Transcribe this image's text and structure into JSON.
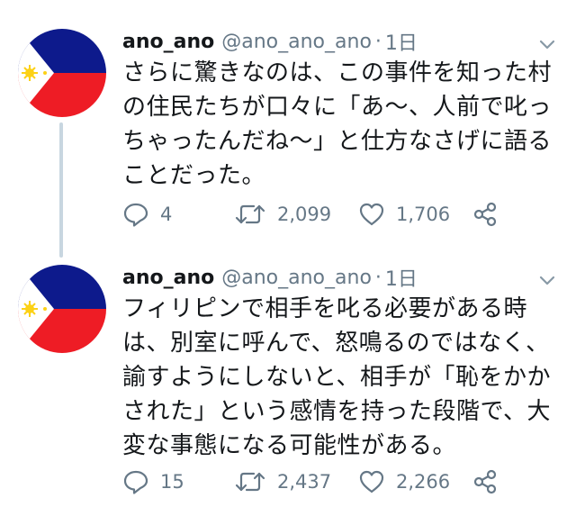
{
  "tweets": [
    {
      "display_name": "ano_ano",
      "handle": "@ano_ano_ano",
      "separator": "·",
      "time": "1日",
      "text": "さらに驚きなのは、この事件を知った村の住民たちが口々に「あ〜、人前で叱っちゃったんだね〜」と仕方なさげに語ることだった。",
      "replies": "4",
      "retweets": "2,099",
      "likes": "1,706"
    },
    {
      "display_name": "ano_ano",
      "handle": "@ano_ano_ano",
      "separator": "·",
      "time": "1日",
      "text": "フィリピンで相手を叱る必要がある時は、別室に呼んで、怒鳴るのではなく、諭すようにしないと、相手が「恥をかかされた」という感情を持った段階で、大変な事態になる可能性がある。",
      "replies": "15",
      "retweets": "2,437",
      "likes": "2,266"
    }
  ],
  "colors": {
    "text": "#14171a",
    "secondary": "#657786",
    "thread_line": "#c8d6e0",
    "flag_blue": "#0d1a8c",
    "flag_red": "#ee1c25",
    "flag_sun": "#fcd116"
  },
  "icons": [
    "philippines-flag-avatar",
    "chevron-down-icon",
    "reply-icon",
    "retweet-icon",
    "like-icon",
    "share-icon"
  ]
}
